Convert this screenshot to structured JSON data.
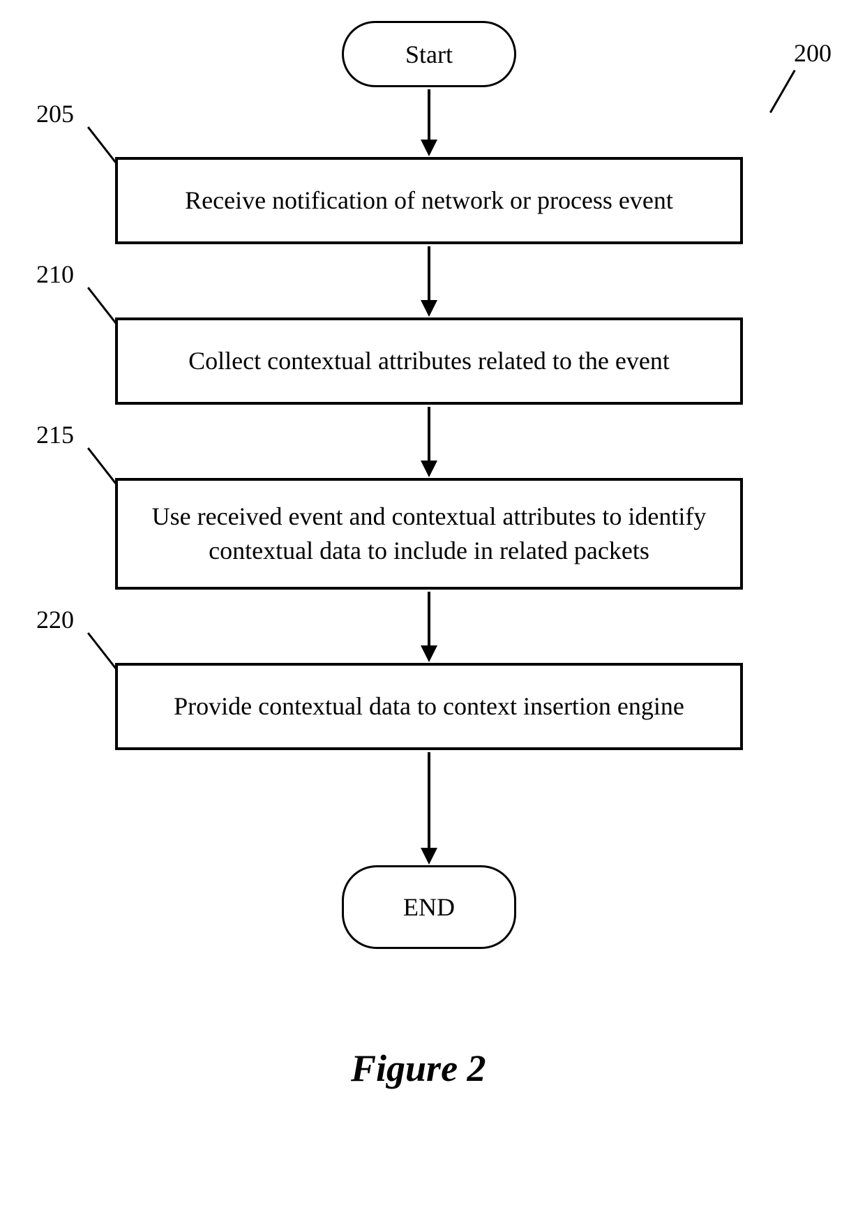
{
  "diagram": {
    "figure_caption": "Figure 2",
    "ref_number": "200",
    "nodes": {
      "start": {
        "label": "Start"
      },
      "step1": {
        "ref": "205",
        "text": "Receive notification of network or process event"
      },
      "step2": {
        "ref": "210",
        "text": "Collect contextual attributes related to the event"
      },
      "step3": {
        "ref": "215",
        "text": "Use received event and contextual attributes to identify contextual data to include in related packets"
      },
      "step4": {
        "ref": "220",
        "text": "Provide contextual data to context insertion engine"
      },
      "end": {
        "label": "END"
      }
    }
  }
}
